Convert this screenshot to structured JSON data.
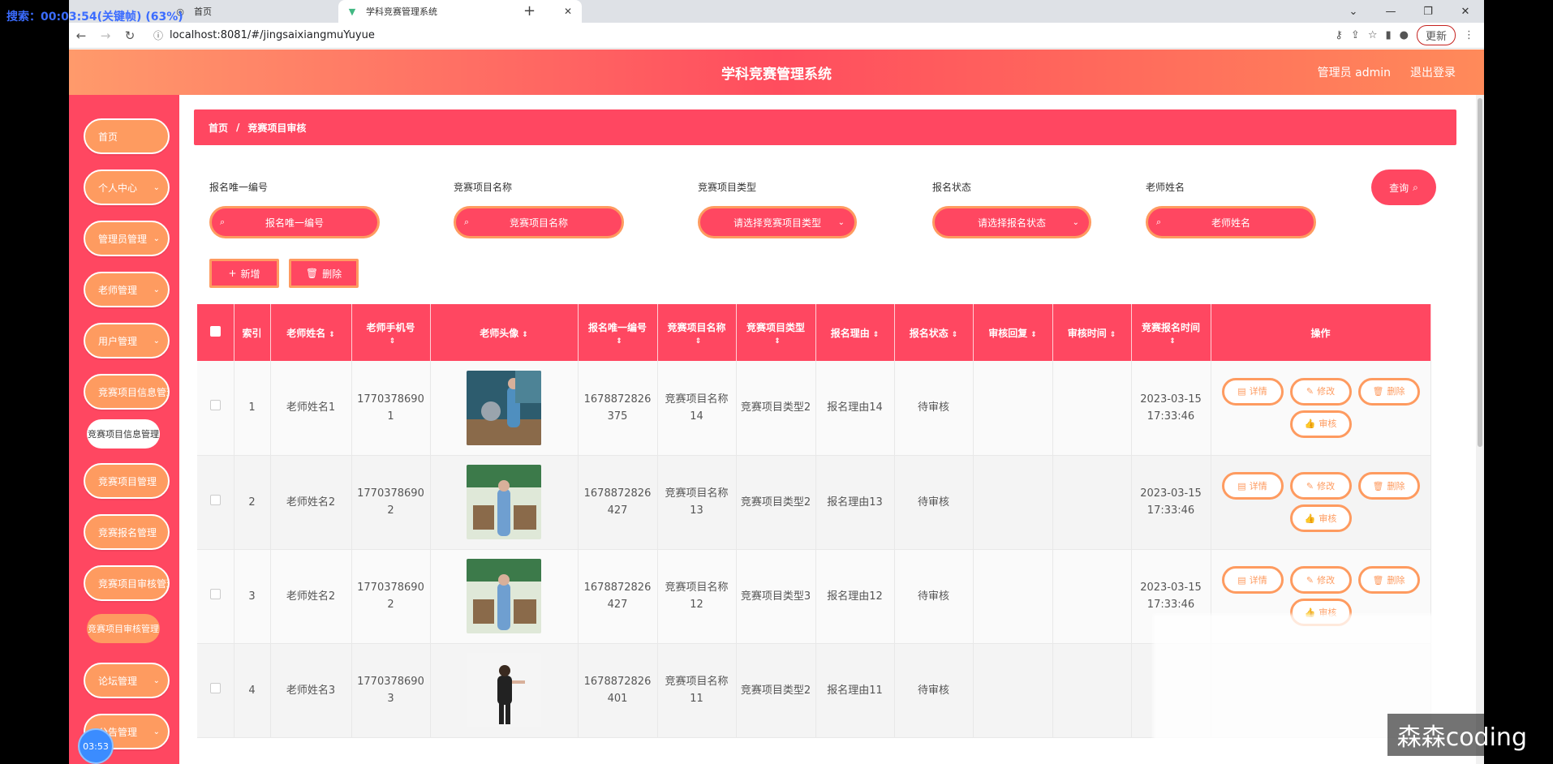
{
  "overlay": {
    "search_text": "搜索：00:03:54(关键帧) (63%)"
  },
  "browser": {
    "tabs": [
      {
        "label": "首页"
      },
      {
        "label": "学科竞赛管理系统"
      }
    ],
    "url": "localhost:8081/#/jingsaixiangmuYuyue",
    "update_label": "更新"
  },
  "header": {
    "title": "学科竞赛管理系统",
    "user_label": "管理员 admin",
    "logout_label": "退出登录"
  },
  "sidebar": {
    "items": [
      {
        "label": "首页"
      },
      {
        "label": "个人中心"
      },
      {
        "label": "管理员管理"
      },
      {
        "label": "老师管理"
      },
      {
        "label": "用户管理"
      },
      {
        "label": "竞赛项目信息管理"
      },
      {
        "label": "竞赛项目信息管理"
      },
      {
        "label": "竞赛项目管理"
      },
      {
        "label": "竞赛报名管理"
      },
      {
        "label": "竞赛项目审核管理"
      },
      {
        "label": "竞赛项目审核管理"
      },
      {
        "label": "论坛管理"
      },
      {
        "label": "公告管理"
      }
    ]
  },
  "breadcrumb": {
    "home": "首页",
    "sep": "/",
    "current": "竞赛项目审核"
  },
  "filters": {
    "f1": {
      "label": "报名唯一编号",
      "placeholder": "报名唯一编号"
    },
    "f2": {
      "label": "竞赛项目名称",
      "placeholder": "竞赛项目名称"
    },
    "f3": {
      "label": "竞赛项目类型",
      "placeholder": "请选择竞赛项目类型"
    },
    "f4": {
      "label": "报名状态",
      "placeholder": "请选择报名状态"
    },
    "f5": {
      "label": "老师姓名",
      "placeholder": "老师姓名"
    },
    "query_label": "查询"
  },
  "actions": {
    "add_label": "新增",
    "delete_label": "删除"
  },
  "table": {
    "headers": {
      "index": "索引",
      "teacher_name": "老师姓名",
      "teacher_phone": "老师手机号",
      "teacher_avatar": "老师头像",
      "reg_id": "报名唯一编号",
      "project_name": "竞赛项目名称",
      "project_type": "竞赛项目类型",
      "reason": "报名理由",
      "status": "报名状态",
      "reply": "审核回复",
      "review_time": "审核时间",
      "reg_time": "竞赛报名时间",
      "ops": "操作"
    },
    "op_labels": {
      "detail": "详情",
      "edit": "修改",
      "delete": "删除",
      "review": "审核"
    },
    "rows": [
      {
        "index": "1",
        "teacher_name": "老师姓名1",
        "teacher_phone": "17703786901",
        "reg_id": "1678872826375",
        "project_name": "竞赛项目名称14",
        "project_type": "竞赛项目类型2",
        "reason": "报名理由14",
        "status": "待审核",
        "reply": "",
        "review_time": "",
        "reg_time": "2023-03-15 17:33:46"
      },
      {
        "index": "2",
        "teacher_name": "老师姓名2",
        "teacher_phone": "17703786902",
        "reg_id": "1678872826427",
        "project_name": "竞赛项目名称13",
        "project_type": "竞赛项目类型2",
        "reason": "报名理由13",
        "status": "待审核",
        "reply": "",
        "review_time": "",
        "reg_time": "2023-03-15 17:33:46"
      },
      {
        "index": "3",
        "teacher_name": "老师姓名2",
        "teacher_phone": "17703786902",
        "reg_id": "1678872826427",
        "project_name": "竞赛项目名称12",
        "project_type": "竞赛项目类型3",
        "reason": "报名理由12",
        "status": "待审核",
        "reply": "",
        "review_time": "",
        "reg_time": "2023-03-15 17:33:46"
      },
      {
        "index": "4",
        "teacher_name": "老师姓名3",
        "teacher_phone": "17703786903",
        "reg_id": "1678872826401",
        "project_name": "竞赛项目名称11",
        "project_type": "竞赛项目类型2",
        "reason": "报名理由11",
        "status": "待审核",
        "reply": "",
        "review_time": "",
        "reg_time": ""
      }
    ]
  },
  "watermark": "森森coding",
  "timer": "03:53"
}
